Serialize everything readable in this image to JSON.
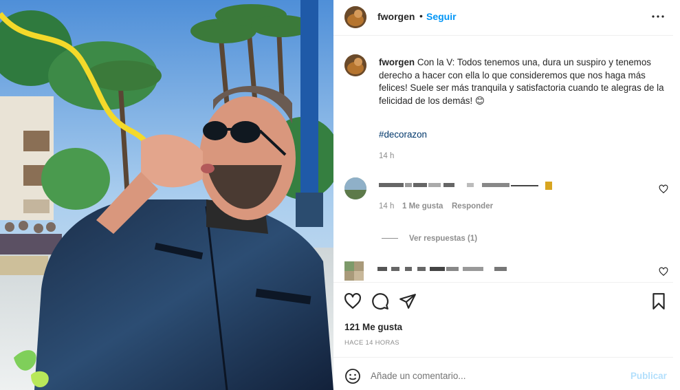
{
  "post": {
    "username": "fworgen",
    "dot": "•",
    "follow_label": "Seguir",
    "more_icon": "more-horizontal-icon"
  },
  "caption": {
    "username": "fworgen",
    "text": "Con la V: Todos tenemos una, dura un suspiro y tenemos derecho a hacer con ella lo que consideremos que nos haga más felices! Suele ser más tranquila y satisfactoria cuando te alegras de la felicidad de los demás! 😊",
    "hashtag": "#decorazon",
    "time": "14 h"
  },
  "comments": [
    {
      "time": "14 h",
      "likes": "1 Me gusta",
      "reply_label": "Responder",
      "view_replies": "Ver respuestas (1)"
    },
    {}
  ],
  "actions": {
    "like_icon": "heart-icon",
    "comment_icon": "comment-icon",
    "share_icon": "share-icon",
    "save_icon": "bookmark-icon"
  },
  "likes_text": "121 Me gusta",
  "time_ago": "HACE 14 HORAS",
  "add_comment": {
    "placeholder": "Añade un comentario...",
    "publish_label": "Publicar",
    "emoji_icon": "smiley-icon"
  },
  "colors": {
    "accent": "#0095f6",
    "publish_disabled": "#b2dffc",
    "hashtag": "#00376b",
    "secondary_text": "#8e8e8e"
  }
}
